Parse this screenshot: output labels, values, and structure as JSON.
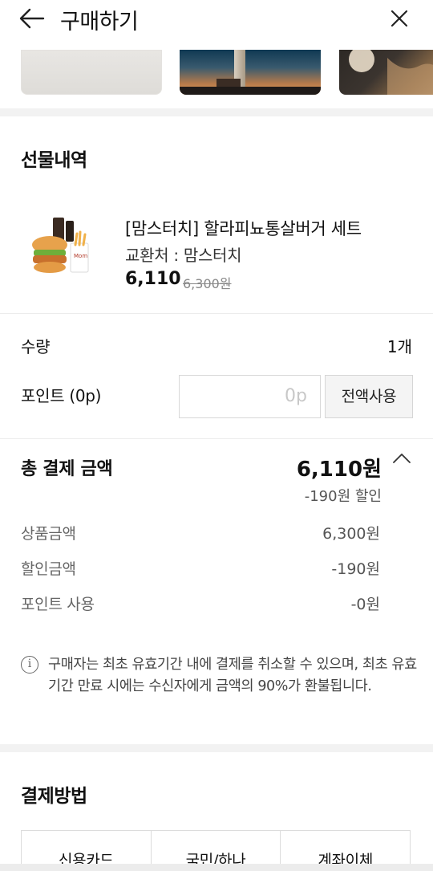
{
  "header": {
    "title": "구매하기",
    "back_icon": "arrow-left-icon",
    "close_icon": "close-icon"
  },
  "gift_section": {
    "title": "선물내역",
    "product": {
      "name": "[맘스터치] 할라피뇨통살버거 세트",
      "store": "교환처 : 맘스터치",
      "price": "6,110",
      "original_price": "6,300원"
    }
  },
  "quantity": {
    "label": "수량",
    "value": "1개"
  },
  "points": {
    "label": "포인트 (0p)",
    "input_placeholder": "0p",
    "use_all_label": "전액사용"
  },
  "total": {
    "label": "총 결제 금액",
    "amount": "6,110원",
    "discount": "-190원 할인",
    "details": [
      {
        "label": "상품금액",
        "value": "6,300원"
      },
      {
        "label": "할인금액",
        "value": "-190원"
      },
      {
        "label": "포인트 사용",
        "value": "-0원"
      }
    ]
  },
  "notice": {
    "icon": "info-icon",
    "icon_glyph": "i",
    "text": "구매자는 최초 유효기간 내에 결제를 취소할 수 있으며, 최초 유효기간 만료 시에는 수신자에게 금액의 90%가 환불됩니다."
  },
  "payment": {
    "title": "결제방법",
    "methods": [
      "신용카드",
      "국민/하나",
      "계좌이체"
    ]
  }
}
